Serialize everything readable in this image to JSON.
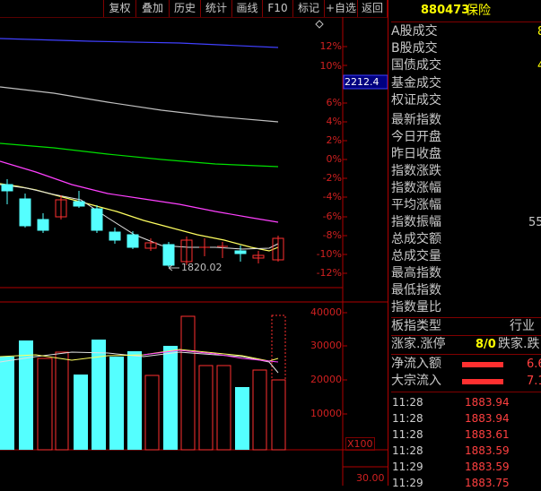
{
  "toolbar": {
    "buttons": [
      "复权",
      "叠加",
      "历史",
      "统计",
      "画线",
      "F10",
      "标记",
      "+自选",
      "返回"
    ]
  },
  "price_axis": {
    "ticks": [
      "12%",
      "10%",
      "6%",
      "4%",
      "2%",
      "0%",
      "-2%",
      "-4%",
      "-6%",
      "-8%",
      "-10%",
      "-12%"
    ],
    "current_label": "2212.4",
    "low_label": "1820.02"
  },
  "volume_axis": {
    "ticks": [
      "40000",
      "30000",
      "20000",
      "10000"
    ],
    "multiplier": "X100",
    "bottom_value": "30.00"
  },
  "side": {
    "code": "880473",
    "name": "保险",
    "rows": [
      "A股成交",
      "B股成交",
      "国债成交",
      "基金成交",
      "权证成交",
      "最新指数",
      "今日开盘",
      "昨日收盘",
      "指数涨跌",
      "指数涨幅",
      "平均涨幅",
      "指数振幅",
      "总成交额",
      "总成交量",
      "最高指数",
      "最低指数",
      "指数量比"
    ],
    "partial_values": {
      "a": "8",
      "b": "4",
      "amp": "55"
    },
    "board_type_label": "板指类型",
    "board_type_value": "行业",
    "up_label": "涨家.涨停",
    "up_value": "8/0",
    "down_label": "跌家.跌",
    "net_inflow_label": "净流入额",
    "net_inflow_value": "6.6",
    "block_inflow_label": "大宗流入",
    "block_inflow_value": "7.1",
    "ticks": [
      {
        "time": "11:28",
        "price": "1883.94"
      },
      {
        "time": "11:28",
        "price": "1883.94"
      },
      {
        "time": "11:28",
        "price": "1883.61"
      },
      {
        "time": "11:28",
        "price": "1883.59"
      },
      {
        "time": "11:29",
        "price": "1883.59"
      },
      {
        "time": "11:29",
        "price": "1883.75"
      }
    ]
  },
  "colors": {
    "up": "#ff3030",
    "down": "#54ffff",
    "ma_white": "#c0c0c0",
    "ma_yellow": "#ffff60",
    "ma_magenta": "#ff40ff",
    "ma_green": "#00e000",
    "ma_blue": "#4040ff"
  }
}
